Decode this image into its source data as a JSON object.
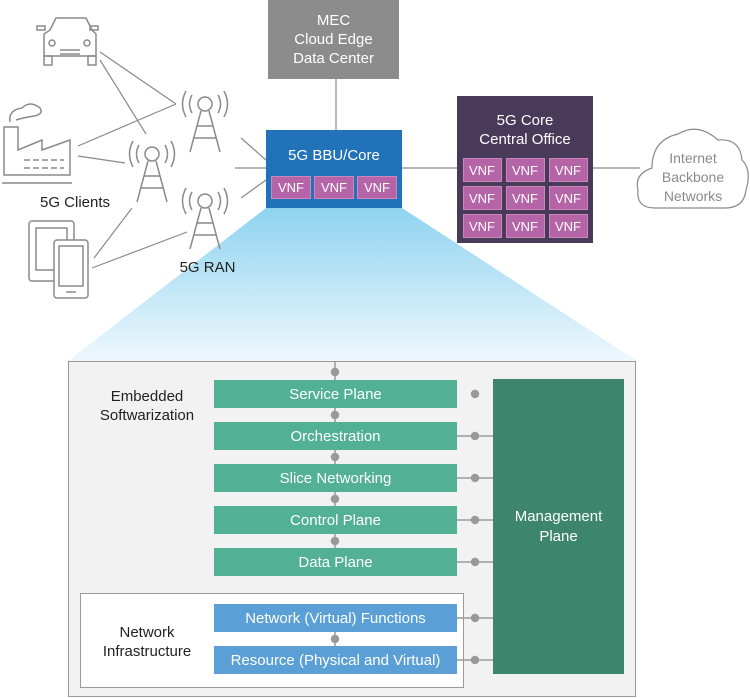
{
  "mec": {
    "lines": [
      "MEC",
      "Cloud Edge",
      "Data Center"
    ]
  },
  "bbu": {
    "title": "5G BBU/Core",
    "vnfs": [
      "VNF",
      "VNF",
      "VNF"
    ]
  },
  "core": {
    "lines": [
      "5G Core",
      "Central Office"
    ],
    "vnfs": [
      "VNF",
      "VNF",
      "VNF",
      "VNF",
      "VNF",
      "VNF",
      "VNF",
      "VNF",
      "VNF"
    ]
  },
  "cloud": {
    "lines": [
      "Internet",
      "Backbone",
      "Networks"
    ]
  },
  "labels": {
    "clients": "5G Clients",
    "ran": "5G RAN"
  },
  "stack": {
    "embedded_label": [
      "Embedded",
      "Softwarization"
    ],
    "infra_label": [
      "Network",
      "Infrastructure"
    ],
    "planes": [
      "Service Plane",
      "Orchestration",
      "Slice Networking",
      "Control Plane",
      "Data Plane"
    ],
    "infra": [
      "Network (Virtual) Functions",
      "Resource (Physical and Virtual)"
    ],
    "management": [
      "Management",
      "Plane"
    ]
  },
  "colors": {
    "mec": "#8c8c8c",
    "bbu": "#2272b9",
    "core": "#4a3a5a",
    "vnf": "#b565a7",
    "plane": "#52b194",
    "infra": "#5a9fd6",
    "management": "#3d866d"
  }
}
